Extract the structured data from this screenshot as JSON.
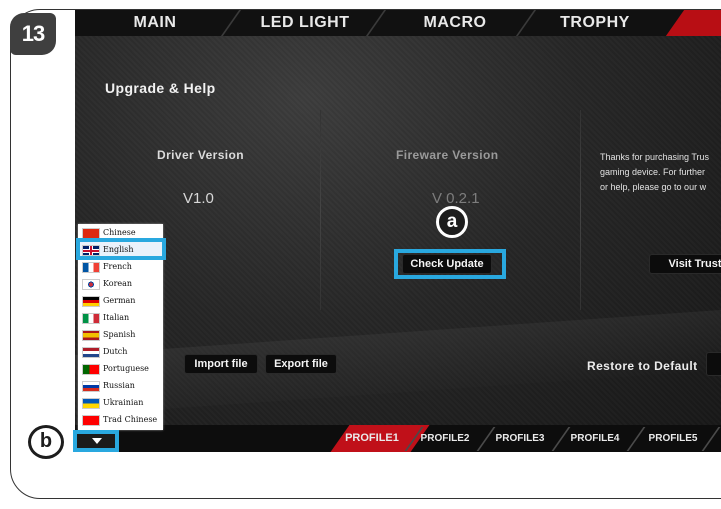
{
  "step_number": "13",
  "nav": {
    "tabs": [
      "MAIN",
      "LED LIGHT",
      "MACRO",
      "TROPHY"
    ]
  },
  "upgrade": {
    "title": "Upgrade & Help",
    "driver_label": "Driver Version",
    "driver_value": "V1.0",
    "firmware_label": "Fireware Version",
    "firmware_value": "V 0.2.1",
    "check_update": "Check Update",
    "thanks_lines": [
      "Thanks for purchasing Trus",
      "gaming device. For further",
      "or help, please go to our w"
    ],
    "visit_button": "Visit Trust"
  },
  "file": {
    "import": "Import file",
    "export": "Export file",
    "restore": "Restore to Default"
  },
  "language_menu": {
    "selected": "English",
    "items": [
      {
        "label": "Chinese",
        "flag": "cn-flag-icon"
      },
      {
        "label": "English",
        "flag": "uk-flag-icon"
      },
      {
        "label": "French",
        "flag": "fr-flag-icon"
      },
      {
        "label": "Korean",
        "flag": "kr-flag-icon"
      },
      {
        "label": "German",
        "flag": "de-flag-icon"
      },
      {
        "label": "Italian",
        "flag": "it-flag-icon"
      },
      {
        "label": "Spanish",
        "flag": "es-flag-icon"
      },
      {
        "label": "Dutch",
        "flag": "nl-flag-icon"
      },
      {
        "label": "Portuguese",
        "flag": "pt-flag-icon"
      },
      {
        "label": "Russian",
        "flag": "ru-flag-icon"
      },
      {
        "label": "Ukrainian",
        "flag": "ua-flag-icon"
      },
      {
        "label": "Trad Chinese",
        "flag": "tw-flag-icon"
      }
    ]
  },
  "profiles": [
    "PROFILE1",
    "PROFILE2",
    "PROFILE3",
    "PROFILE4",
    "PROFILE5"
  ],
  "active_profile": "PROFILE1",
  "callouts": {
    "a": "a",
    "b": "b"
  },
  "colors": {
    "accent_red": "#c01019",
    "highlight_blue": "#29a8df"
  }
}
